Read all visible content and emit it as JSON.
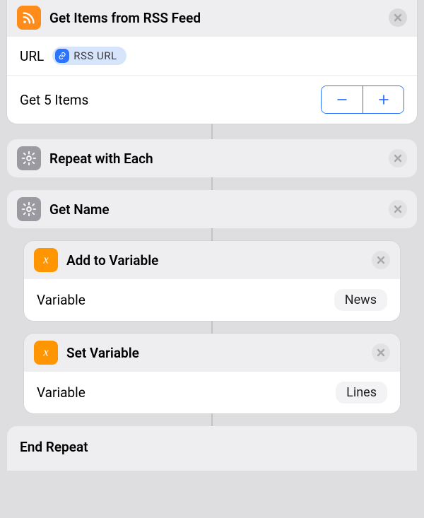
{
  "rss": {
    "title": "Get Items from RSS Feed",
    "url_label": "URL",
    "token_text": "RSS URL",
    "items_label": "Get 5 Items"
  },
  "repeat": {
    "title": "Repeat with Each",
    "end": "End Repeat"
  },
  "getname": {
    "title": "Get Name"
  },
  "addvar": {
    "title": "Add to Variable",
    "field": "Variable",
    "value": "News"
  },
  "setvar": {
    "title": "Set Variable",
    "field": "Variable",
    "value": "Lines"
  }
}
